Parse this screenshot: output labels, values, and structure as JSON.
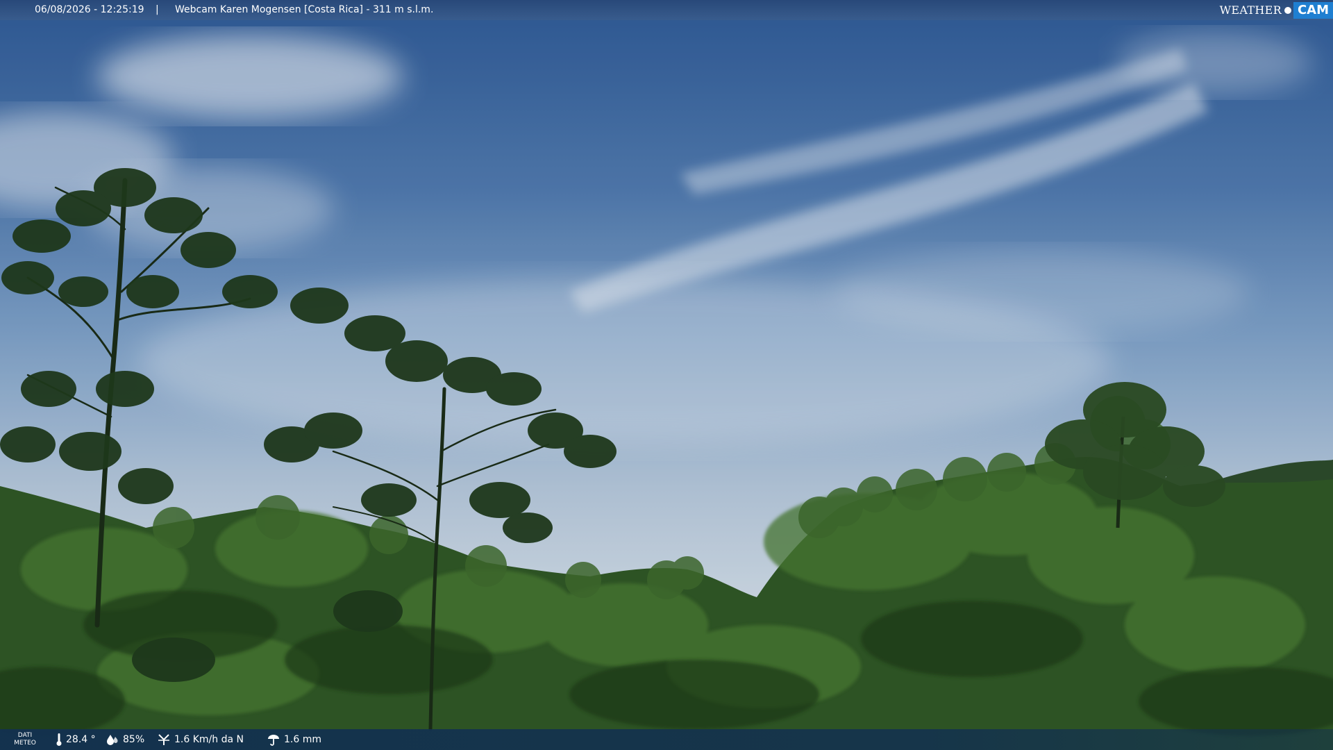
{
  "header": {
    "datetime": "06/08/2026 - 12:25:19",
    "separator": "|",
    "title": "Webcam Karen Mogensen [Costa Rica] - 311 m s.l.m."
  },
  "logo": {
    "weather": "WEATHER",
    "cam": "CAM"
  },
  "weather_bar": {
    "label_line1": "DATI",
    "label_line2": "METEO",
    "temperature": "28.4 °",
    "humidity": "85%",
    "wind": "1.6 Km/h da N",
    "rain": "1.6 mm"
  },
  "colors": {
    "sky_top": "#2e5a96",
    "sky_mid": "#7fa2c8",
    "sky_low": "#c9d6e2",
    "foliage_dark": "#1f3a18",
    "foliage": "#2f5724",
    "foliage_light": "#4a7a33",
    "logo_cam_bg": "#1f7fd1"
  },
  "icons": [
    "thermometer-icon",
    "humidity-icon",
    "wind-icon",
    "rain-icon"
  ]
}
